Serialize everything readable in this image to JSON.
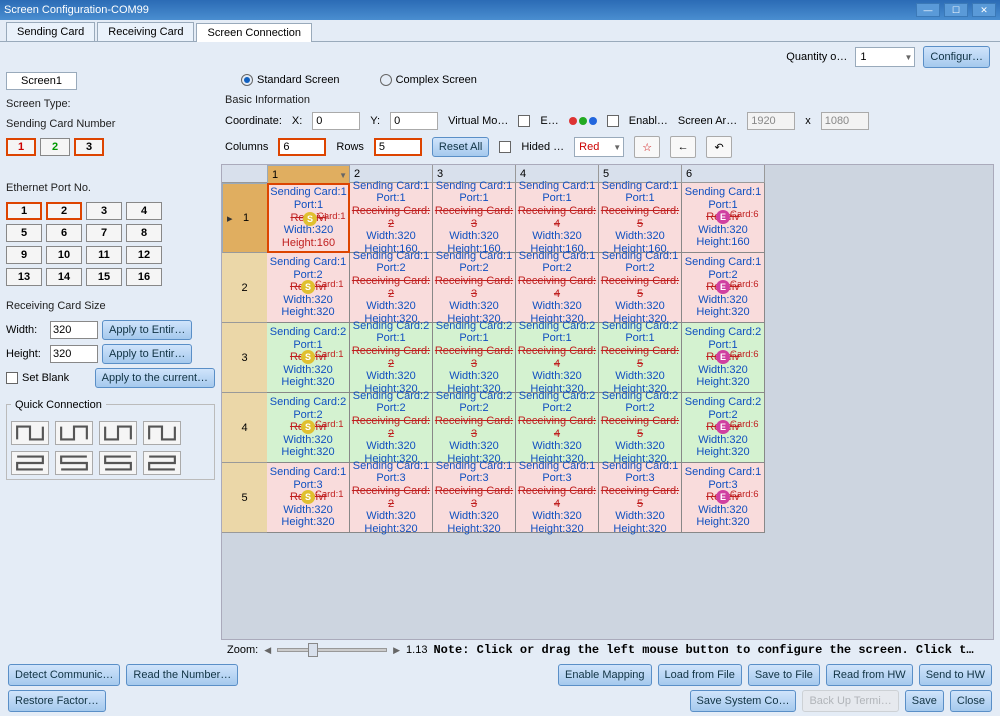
{
  "window": {
    "title": "Screen Configuration-COM99"
  },
  "tabs": {
    "sending": "Sending Card",
    "receiving": "Receiving Card",
    "screen": "Screen Connection"
  },
  "qty": {
    "label": "Quantity o…",
    "value": "1"
  },
  "configure": "Configur…",
  "screenTab": "Screen1",
  "screenType": {
    "label": "Screen Type:",
    "std": "Standard Screen",
    "cplx": "Complex Screen"
  },
  "sendingCardNumber": {
    "label": "Sending Card Number",
    "vals": [
      "1",
      "2",
      "3"
    ]
  },
  "ethernet": {
    "label": "Ethernet Port No.",
    "vals": [
      "1",
      "2",
      "3",
      "4",
      "5",
      "6",
      "7",
      "8",
      "9",
      "10",
      "11",
      "12",
      "13",
      "14",
      "15",
      "16"
    ]
  },
  "rcsize": {
    "label": "Receiving Card Size",
    "width": "Width:",
    "height": "Height:",
    "wval": "320",
    "hval": "320",
    "apply1": "Apply to Entir…",
    "apply2": "Apply to Entir…",
    "apply3": "Apply to the current…"
  },
  "setblank": "Set Blank",
  "quickconn": "Quick Connection",
  "basic": {
    "title": "Basic Information",
    "coord": "Coordinate:",
    "x": "X:",
    "xv": "0",
    "y": "Y:",
    "yv": "0",
    "virtual": "Virtual Mo…",
    "evm": "E…",
    "enabl": "Enabl…",
    "screenar": "Screen Ar…",
    "arw": "1920",
    "arh": "1080",
    "columns": "Columns",
    "colv": "6",
    "rows": "Rows",
    "rowv": "5",
    "reset": "Reset All",
    "hided": "Hided …",
    "color": "Red"
  },
  "grid": {
    "cols": [
      "1",
      "2",
      "3",
      "4",
      "5",
      "6"
    ],
    "rownums": [
      "1",
      "2",
      "3",
      "4",
      "5"
    ],
    "cells": [
      [
        {
          "sc": "1",
          "p": "1",
          "rc": "1",
          "w": "320",
          "h": "160",
          "cls": "pink",
          "first": true,
          "s": true
        },
        {
          "sc": "1",
          "p": "1",
          "rc": "2",
          "w": "320",
          "h": "160",
          "cls": "pink"
        },
        {
          "sc": "1",
          "p": "1",
          "rc": "3",
          "w": "320",
          "h": "160",
          "cls": "pink"
        },
        {
          "sc": "1",
          "p": "1",
          "rc": "4",
          "w": "320",
          "h": "160",
          "cls": "pink"
        },
        {
          "sc": "1",
          "p": "1",
          "rc": "5",
          "w": "320",
          "h": "160",
          "cls": "pink"
        },
        {
          "sc": "1",
          "p": "1",
          "rc": "6",
          "w": "320",
          "h": "160",
          "cls": "pink",
          "e": true
        }
      ],
      [
        {
          "sc": "1",
          "p": "2",
          "rc": "1",
          "w": "320",
          "h": "320",
          "cls": "pink",
          "s": true
        },
        {
          "sc": "1",
          "p": "2",
          "rc": "2",
          "w": "320",
          "h": "320",
          "cls": "pink"
        },
        {
          "sc": "1",
          "p": "2",
          "rc": "3",
          "w": "320",
          "h": "320",
          "cls": "pink"
        },
        {
          "sc": "1",
          "p": "2",
          "rc": "4",
          "w": "320",
          "h": "320",
          "cls": "pink"
        },
        {
          "sc": "1",
          "p": "2",
          "rc": "5",
          "w": "320",
          "h": "320",
          "cls": "pink"
        },
        {
          "sc": "1",
          "p": "2",
          "rc": "6",
          "w": "320",
          "h": "320",
          "cls": "pink",
          "e": true
        }
      ],
      [
        {
          "sc": "2",
          "p": "1",
          "rc": "1",
          "w": "320",
          "h": "320",
          "cls": "green",
          "s": true
        },
        {
          "sc": "2",
          "p": "1",
          "rc": "2",
          "w": "320",
          "h": "320",
          "cls": "green"
        },
        {
          "sc": "2",
          "p": "1",
          "rc": "3",
          "w": "320",
          "h": "320",
          "cls": "green"
        },
        {
          "sc": "2",
          "p": "1",
          "rc": "4",
          "w": "320",
          "h": "320",
          "cls": "green"
        },
        {
          "sc": "2",
          "p": "1",
          "rc": "5",
          "w": "320",
          "h": "320",
          "cls": "green"
        },
        {
          "sc": "2",
          "p": "1",
          "rc": "6",
          "w": "320",
          "h": "320",
          "cls": "green",
          "e": true
        }
      ],
      [
        {
          "sc": "2",
          "p": "2",
          "rc": "1",
          "w": "320",
          "h": "320",
          "cls": "green",
          "s": true
        },
        {
          "sc": "2",
          "p": "2",
          "rc": "2",
          "w": "320",
          "h": "320",
          "cls": "green"
        },
        {
          "sc": "2",
          "p": "2",
          "rc": "3",
          "w": "320",
          "h": "320",
          "cls": "green"
        },
        {
          "sc": "2",
          "p": "2",
          "rc": "4",
          "w": "320",
          "h": "320",
          "cls": "green"
        },
        {
          "sc": "2",
          "p": "2",
          "rc": "5",
          "w": "320",
          "h": "320",
          "cls": "green"
        },
        {
          "sc": "2",
          "p": "2",
          "rc": "6",
          "w": "320",
          "h": "320",
          "cls": "green",
          "e": true
        }
      ],
      [
        {
          "sc": "1",
          "p": "3",
          "rc": "1",
          "w": "320",
          "h": "320",
          "cls": "pink",
          "s": true
        },
        {
          "sc": "1",
          "p": "3",
          "rc": "2",
          "w": "320",
          "h": "320",
          "cls": "pink"
        },
        {
          "sc": "1",
          "p": "3",
          "rc": "3",
          "w": "320",
          "h": "320",
          "cls": "pink"
        },
        {
          "sc": "1",
          "p": "3",
          "rc": "4",
          "w": "320",
          "h": "320",
          "cls": "pink"
        },
        {
          "sc": "1",
          "p": "3",
          "rc": "5",
          "w": "320",
          "h": "320",
          "cls": "pink"
        },
        {
          "sc": "1",
          "p": "3",
          "rc": "6",
          "w": "320",
          "h": "320",
          "cls": "pink",
          "e": true
        }
      ]
    ]
  },
  "zoom": {
    "label": "Zoom:",
    "val": "1.13",
    "note": "Note: Click or drag the left mouse button to configure the screen. Click t…"
  },
  "bottom": {
    "detect": "Detect Communic…",
    "readnum": "Read the Number…",
    "enablemap": "Enable Mapping",
    "loadfile": "Load from File",
    "savefile": "Save to File",
    "readhw": "Read from HW",
    "sendhw": "Send to HW",
    "restore": "Restore Factor…",
    "savesys": "Save System Co…",
    "backup": "Back Up Termi…",
    "save": "Save",
    "close": "Close"
  }
}
